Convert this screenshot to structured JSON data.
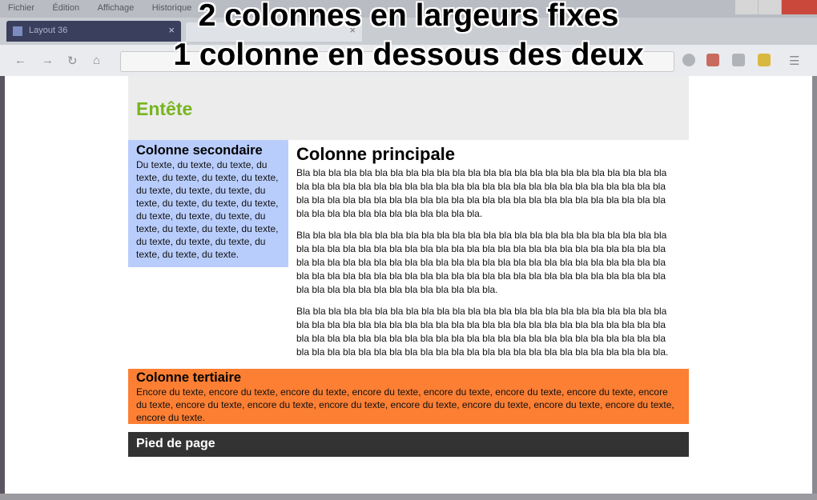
{
  "overlay": {
    "line1": "2 colonnes en largeurs fixes",
    "line2": "1 colonne en dessous des deux"
  },
  "browser": {
    "menu": [
      "Fichier",
      "Édition",
      "Affichage",
      "Historique"
    ],
    "tab_active_label": "Layout 36",
    "tab_close": "×",
    "tab2_close": "×",
    "nav_icons": [
      "back-icon",
      "forward-icon",
      "reload-icon",
      "home-icon"
    ]
  },
  "page": {
    "header_title": "Entête",
    "secondary": {
      "title": "Colonne secondaire",
      "text": "Du texte, du texte, du texte, du texte, du texte, du texte, du texte, du texte, du texte, du texte, du texte, du texte, du texte, du texte, du texte, du texte, du texte, du texte, du texte, du texte, du texte, du texte, du texte, du texte, du texte, du texte, du texte."
    },
    "main": {
      "title": "Colonne principale",
      "paragraphs": [
        "Bla bla bla bla bla bla bla bla bla bla bla bla bla bla bla bla bla bla bla bla bla bla bla bla bla bla bla bla bla bla bla bla bla bla bla bla bla bla bla bla bla bla bla bla bla bla bla bla bla bla bla bla bla bla bla bla bla bla bla bla bla bla bla bla bla bla bla bla bla bla bla bla bla bla bla bla bla bla bla bla bla bla bla bla.",
        "Bla bla bla bla bla bla bla bla bla bla bla bla bla bla bla bla bla bla bla bla bla bla bla bla bla bla bla bla bla bla bla bla bla bla bla bla bla bla bla bla bla bla bla bla bla bla bla bla bla bla bla bla bla bla bla bla bla bla bla bla bla bla bla bla bla bla bla bla bla bla bla bla bla bla bla bla bla bla bla bla bla bla bla bla bla bla bla bla bla bla bla bla bla bla bla bla bla bla bla bla bla bla bla bla bla bla bla bla bla.",
        "Bla bla bla bla bla bla bla bla bla bla bla bla bla bla bla bla bla bla bla bla bla bla bla bla bla bla bla bla bla bla bla bla bla bla bla bla bla bla bla bla bla bla bla bla bla bla bla bla bla bla bla bla bla bla bla bla bla bla bla bla bla bla bla bla bla bla bla bla bla bla bla bla bla bla bla bla bla bla bla bla bla bla bla bla bla bla bla bla bla bla bla bla bla bla bla bla."
      ]
    },
    "tertiary": {
      "title": "Colonne tertiaire",
      "text": "Encore du texte, encore du texte, encore du texte, encore du texte, encore du texte, encore du texte, encore du texte, encore du texte, encore du texte, encore du texte, encore du texte, encore du texte, encore du texte, encore du texte, encore du texte, encore du texte."
    },
    "footer": "Pied de page"
  },
  "colors": {
    "header_bg": "#ececec",
    "header_title": "#76b51d",
    "secondary_bg": "#b9cdfc",
    "tertiary_bg": "#fd7f33",
    "footer_bg": "#333333"
  }
}
